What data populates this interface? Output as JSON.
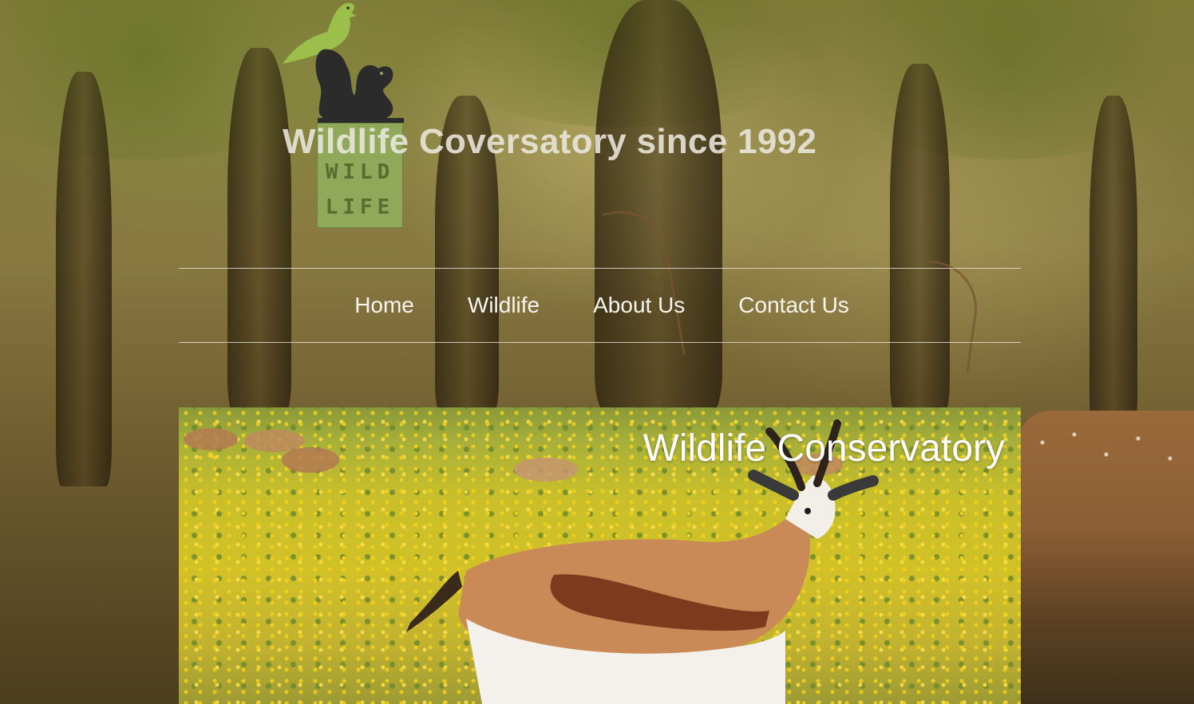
{
  "site": {
    "tagline": "Wildlife Coversatory since 1992",
    "logo": {
      "alt": "WILD LIFE logo with bird and squirrel",
      "line1": "WILD",
      "line2": "LIFE",
      "icons": [
        "bird-icon",
        "squirrel-icon"
      ]
    }
  },
  "nav": {
    "items": [
      {
        "label": "Home"
      },
      {
        "label": "Wildlife"
      },
      {
        "label": "About Us"
      },
      {
        "label": "Contact Us"
      }
    ]
  },
  "hero": {
    "title": "Wildlife Conservatory"
  }
}
